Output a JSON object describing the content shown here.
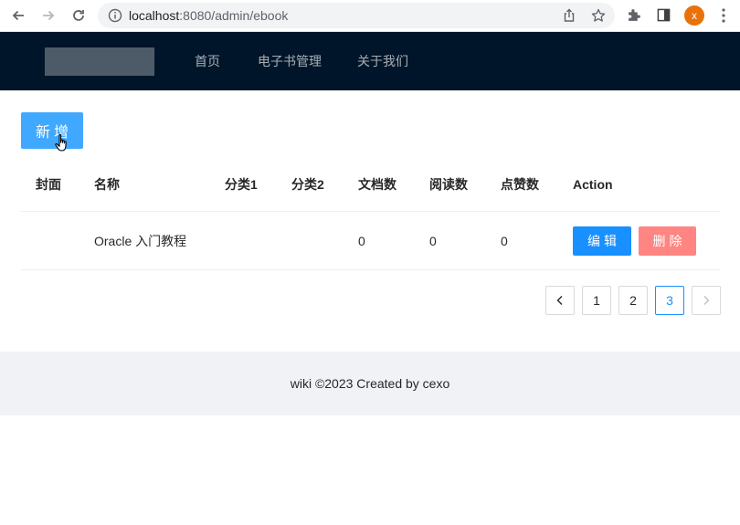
{
  "browser": {
    "url_host": "localhost",
    "url_rest": ":8080/admin/ebook",
    "profile_initial": "x"
  },
  "header": {
    "menu": [
      {
        "label": "首页"
      },
      {
        "label": "电子书管理"
      },
      {
        "label": "关于我们"
      }
    ]
  },
  "toolbar": {
    "add_label": "新增"
  },
  "table": {
    "columns": [
      "封面",
      "名称",
      "分类1",
      "分类2",
      "文档数",
      "阅读数",
      "点赞数",
      "Action"
    ],
    "rows": [
      {
        "cover": "",
        "name": "Oracle 入门教程",
        "category1": "",
        "category2": "",
        "doc_count": "0",
        "view_count": "0",
        "vote_count": "0",
        "edit_label": "编辑",
        "delete_label": "删除"
      }
    ]
  },
  "pagination": {
    "pages": [
      "1",
      "2",
      "3"
    ],
    "current": "3"
  },
  "footer": {
    "text": "wiki ©2023 Created by cexo"
  },
  "colors": {
    "header_bg": "#001529",
    "primary": "#1890ff",
    "add_button": "#40a9ff",
    "danger": "#ff7875",
    "footer_bg": "#f0f2f5",
    "profile": "#e8710a"
  }
}
